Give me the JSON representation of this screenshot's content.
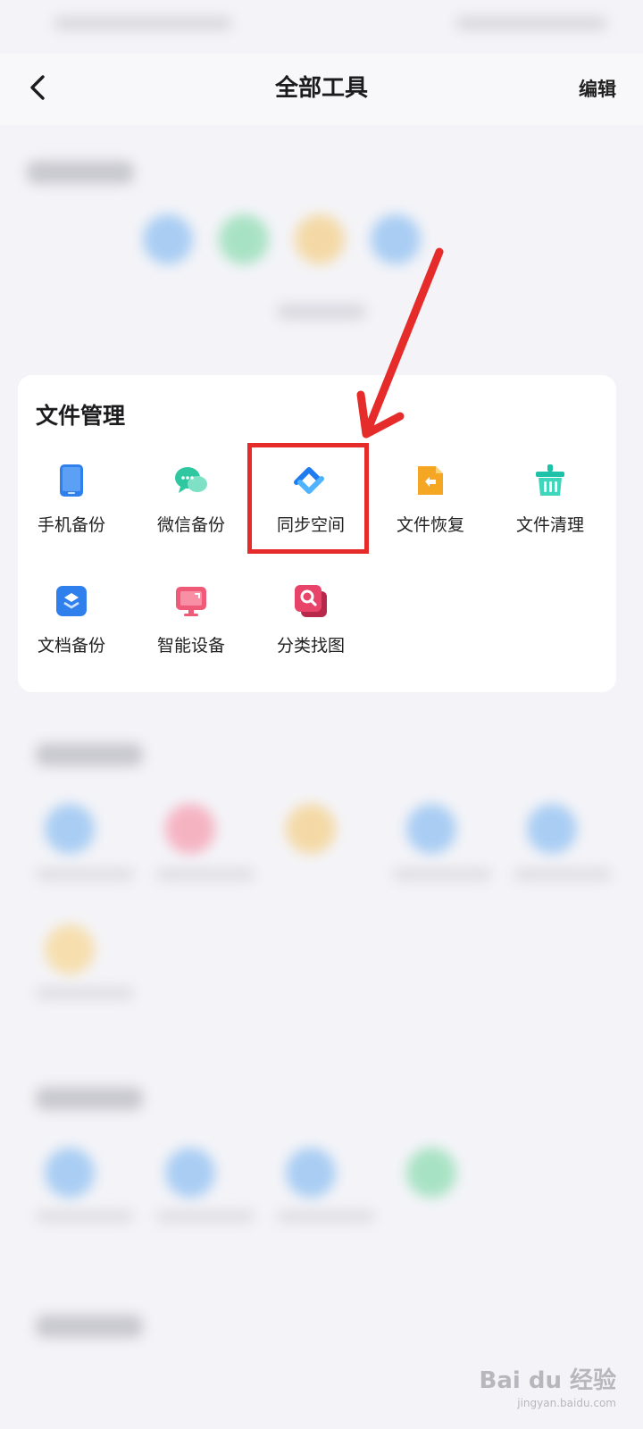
{
  "header": {
    "title": "全部工具",
    "edit_label": "编辑"
  },
  "file_management": {
    "title": "文件管理",
    "tools": [
      {
        "label": "手机备份",
        "icon": "phone-backup-icon",
        "color": "#2f80ed"
      },
      {
        "label": "微信备份",
        "icon": "wechat-backup-icon",
        "color": "#2fc7a0"
      },
      {
        "label": "同步空间",
        "icon": "sync-space-icon",
        "color": "#1f7cf0"
      },
      {
        "label": "文件恢复",
        "icon": "file-restore-icon",
        "color": "#f5a623"
      },
      {
        "label": "文件清理",
        "icon": "file-clean-icon",
        "color": "#1ec2a8"
      },
      {
        "label": "文档备份",
        "icon": "doc-backup-icon",
        "color": "#2f80ed"
      },
      {
        "label": "智能设备",
        "icon": "smart-device-icon",
        "color": "#ee5a78"
      },
      {
        "label": "分类找图",
        "icon": "photo-search-icon",
        "color": "#e8446a"
      }
    ]
  },
  "annotation": {
    "highlight_color": "#e62b2b"
  },
  "watermark": {
    "brand": "Bai du 经验",
    "url": "jingyan.baidu.com"
  }
}
